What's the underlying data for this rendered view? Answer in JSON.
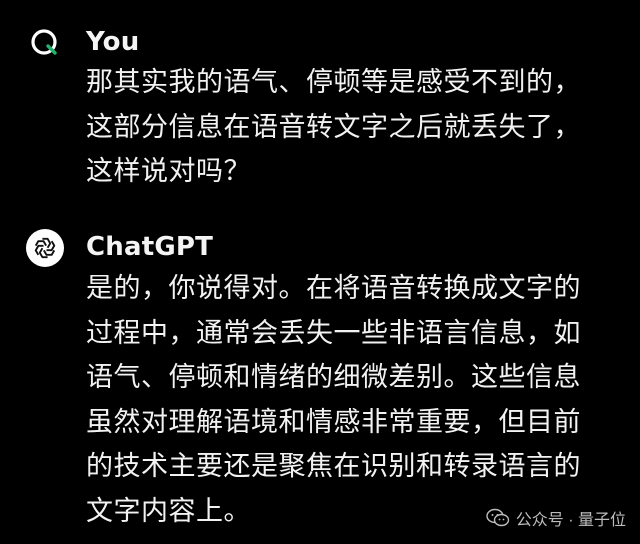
{
  "conversation": {
    "messages": [
      {
        "sender": "You",
        "avatar_icon": "user-q-icon",
        "lines": [
          "那其实我的语气、停顿等是感受不到的，",
          "这部分信息在语音转文字之后就丢失了，",
          "这样说对吗？"
        ]
      },
      {
        "sender": "ChatGPT",
        "avatar_icon": "openai-logo-icon",
        "lines": [
          "是的，你说得对。在将语音转换成文字的",
          "过程中，通常会丢失一些非语言信息，如",
          "语气、停顿和情绪的细微差别。这些信息",
          "虽然对理解语境和情感非常重要，但目前",
          "的技术主要还是聚焦在识别和转录语言的",
          "文字内容上。"
        ]
      }
    ]
  },
  "watermark": {
    "text": "公众号 · 量子位",
    "icon": "wechat-icon"
  },
  "colors": {
    "background": "#000000",
    "text": "#f2f2f2",
    "user_avatar_ring": "#ffffff",
    "user_avatar_accent": "#23b26d",
    "bot_avatar_bg": "#ffffff"
  }
}
